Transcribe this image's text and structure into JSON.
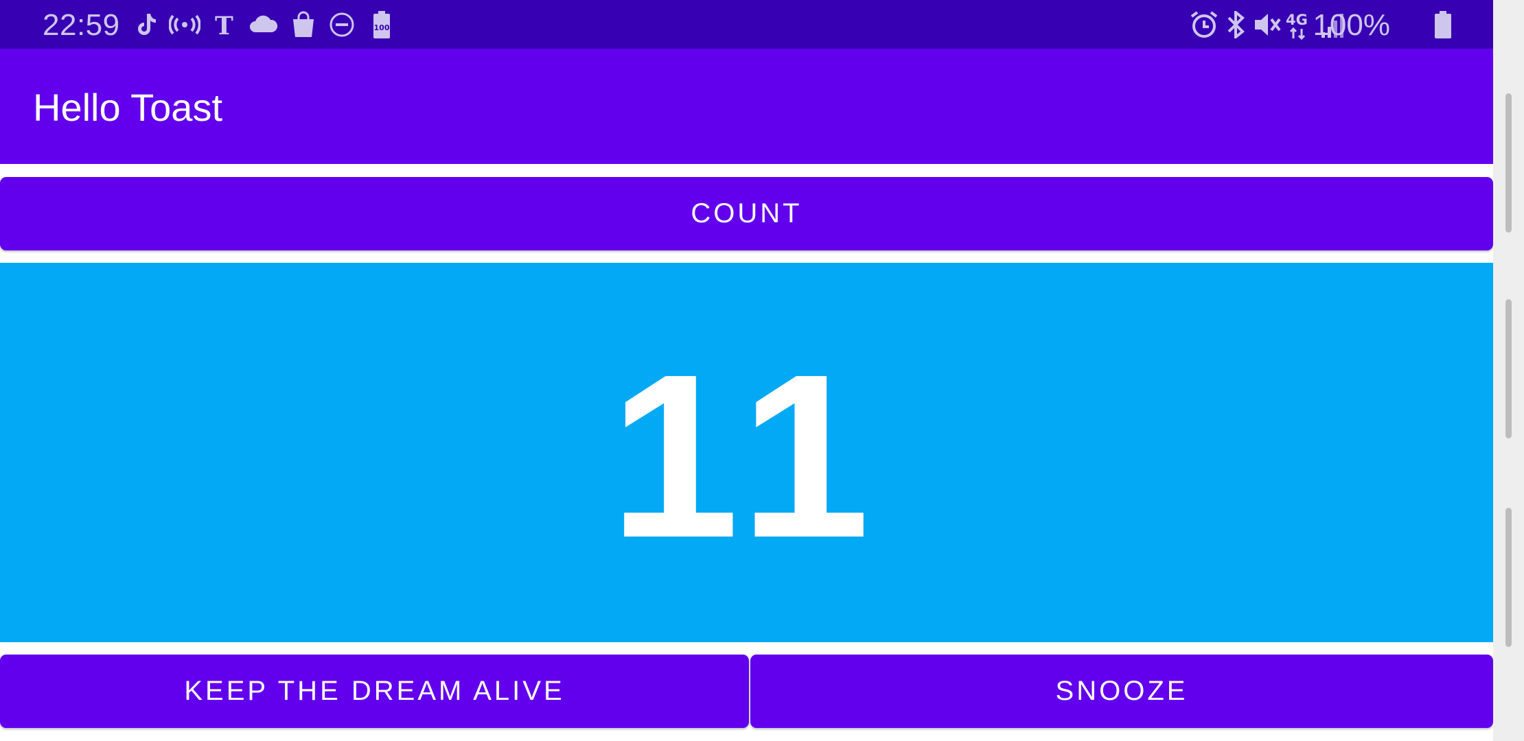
{
  "status_bar": {
    "time": "22:59",
    "left_icons": [
      "tiktok-icon",
      "broadcast-icon",
      "nytimes-icon",
      "cloud-icon",
      "shopping-bag-icon",
      "do-not-disturb-icon",
      "battery-saver-icon"
    ],
    "battery_saver_label": "100",
    "right_icons": [
      "alarm-icon",
      "bluetooth-icon",
      "mute-icon",
      "4g-lte-icon",
      "signal-icon",
      "battery-icon"
    ],
    "network_label": "4G",
    "battery_percent": "100%",
    "colors": {
      "background": "#3700B3",
      "foreground": "#cfc6ee"
    }
  },
  "toolbar": {
    "title": "Hello Toast",
    "color": "#6200EE"
  },
  "buttons": {
    "count": "COUNT",
    "keep_dream_alive": "KEEP THE DREAM ALIVE",
    "snooze": "SNOOZE",
    "color": "#6200EE"
  },
  "counter": {
    "value": "11",
    "background": "#03A9F4",
    "text_color": "#ffffff"
  }
}
